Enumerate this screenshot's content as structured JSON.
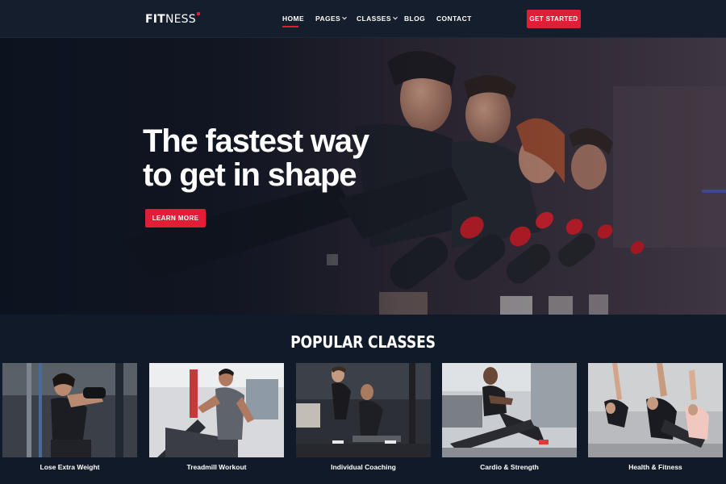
{
  "brand": {
    "strong": "FIT",
    "light": "NESS"
  },
  "nav": {
    "items": [
      {
        "label": "HOME",
        "active": true,
        "dropdown": false
      },
      {
        "label": "PAGES",
        "active": false,
        "dropdown": true
      },
      {
        "label": "CLASSES",
        "active": false,
        "dropdown": true
      },
      {
        "label": "BLOG",
        "active": false,
        "dropdown": false
      },
      {
        "label": "CONTACT",
        "active": false,
        "dropdown": false
      }
    ],
    "cta_label": "GET STARTED"
  },
  "hero": {
    "title_line1": "The fastest way",
    "title_line2": "to get in shape",
    "button_label": "LEARN MORE"
  },
  "classes": {
    "title": "POPULAR CLASSES",
    "items": [
      {
        "label": "Lose Extra Weight"
      },
      {
        "label": "Treadmill Workout"
      },
      {
        "label": "Individual Coaching"
      },
      {
        "label": "Cardio & Strength"
      },
      {
        "label": "Health & Fitness"
      }
    ]
  },
  "colors": {
    "accent": "#e01f36",
    "background": "#101a28",
    "header": "#141e2d",
    "text": "#ffffff"
  }
}
